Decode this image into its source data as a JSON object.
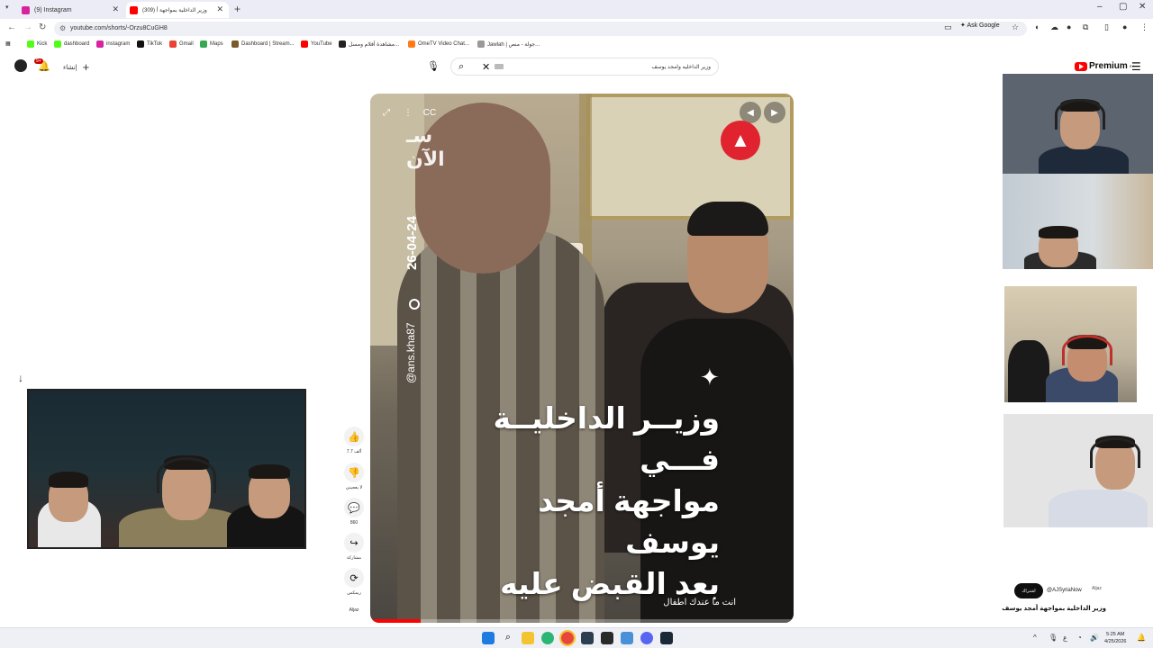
{
  "browser": {
    "tabs": [
      {
        "title": "(9) Instagram",
        "active": false,
        "favicon_color": "#d6249f"
      },
      {
        "title": "(309) وزير الداخلية بمواجهة أ",
        "active": true,
        "favicon_color": "#ff0000"
      }
    ],
    "new_tab": "+",
    "window_controls": [
      "–",
      "▢",
      "✕"
    ],
    "url": "youtube.com/shorts/-Orzu8CuGH8",
    "ask_google": "Ask Google",
    "bookmarks": [
      {
        "label": "Kick",
        "color": "#53fc18"
      },
      {
        "label": "dashboard",
        "color": "#53fc18"
      },
      {
        "label": "instagram",
        "color": "#d6249f"
      },
      {
        "label": "TikTok",
        "color": "#111111"
      },
      {
        "label": "Gmail",
        "color": "#ea4335"
      },
      {
        "label": "Maps",
        "color": "#34a853"
      },
      {
        "label": "Dashboard | Stream...",
        "color": "#7a5a2a"
      },
      {
        "label": "YouTube",
        "color": "#ff0000"
      },
      {
        "label": "مشاهدة أفلام ومسل...",
        "color": "#222222"
      },
      {
        "label": "OmeTV Video Chat...",
        "color": "#ff7a1a"
      },
      {
        "label": "Jawlah | جولة - منص...",
        "color": "#999999"
      }
    ]
  },
  "youtube": {
    "notification_count": "9+",
    "create_label": "إنشاء",
    "search_query": "وزير الداخليه وامجد يوسف",
    "logo_text": "Premium",
    "logo_sup": "SY",
    "short": {
      "watermark_date": "26-04-24",
      "watermark_user": "@ans.kha87",
      "caption_lines": [
        "وزيــر الداخليــة فـــي",
        "مواجهة أمجد يوسف",
        "بعد القبض عليه"
      ],
      "subtitle": "انت ما عندك اطفال",
      "progress_fraction": 0.12
    },
    "actions": [
      {
        "icon": "👍",
        "label": "7.7 ألف",
        "name": "like"
      },
      {
        "icon": "👎",
        "label": "لا يعجبني",
        "name": "dislike"
      },
      {
        "icon": "💬",
        "label": "860",
        "name": "comments"
      },
      {
        "icon": "↪",
        "label": "مشاركة",
        "name": "share"
      },
      {
        "icon": "⟳",
        "label": "ريمكس",
        "name": "remix"
      }
    ],
    "channel": {
      "subscribe_label": "اشتراك",
      "handle": "@AJSyriaNow",
      "avatar_text": "Aljaz"
    },
    "video_title": "وزير الداخلية بمواجهة أمجد يوسف"
  },
  "taskbar": {
    "time": "5:25 AM",
    "date": "4/25/2026"
  },
  "colors": {
    "accent_red": "#ff0000",
    "warning_red": "#e0232e",
    "chrome_bg": "#ececf6"
  }
}
